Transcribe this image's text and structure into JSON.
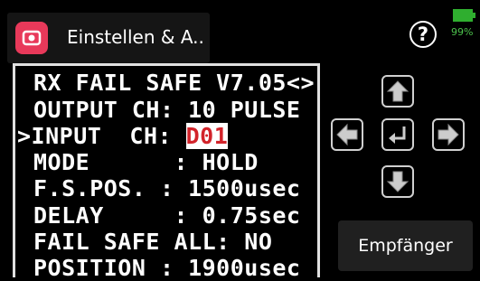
{
  "header": {
    "title": "Einstellen & A..",
    "app_icon": "camera-app-icon"
  },
  "status": {
    "battery_percent": "99%",
    "battery_color": "#2fae2f",
    "help_icon": "question-icon",
    "help_label": "?"
  },
  "screen": {
    "lines": [
      {
        "text": "RX FAIL SAFE V7.05<>"
      },
      {
        "text": "OUTPUT CH: 10 PULSE"
      },
      {
        "prefix": ">INPUT  CH: ",
        "value": "D01"
      },
      {
        "text": "MODE      : HOLD"
      },
      {
        "text": "F.S.POS. : 1500usec"
      },
      {
        "text": "DELAY     : 0.75sec"
      },
      {
        "text": "FAIL SAFE ALL: NO"
      },
      {
        "text": "POSITION : 1900usec"
      }
    ],
    "highlight_color": "#d2232a"
  },
  "keypad": {
    "up": "arrow-up-icon",
    "left": "arrow-left-icon",
    "enter": "enter-icon",
    "right": "arrow-right-icon",
    "down": "arrow-down-icon"
  },
  "receiver_button": {
    "label": "Empfänger"
  }
}
